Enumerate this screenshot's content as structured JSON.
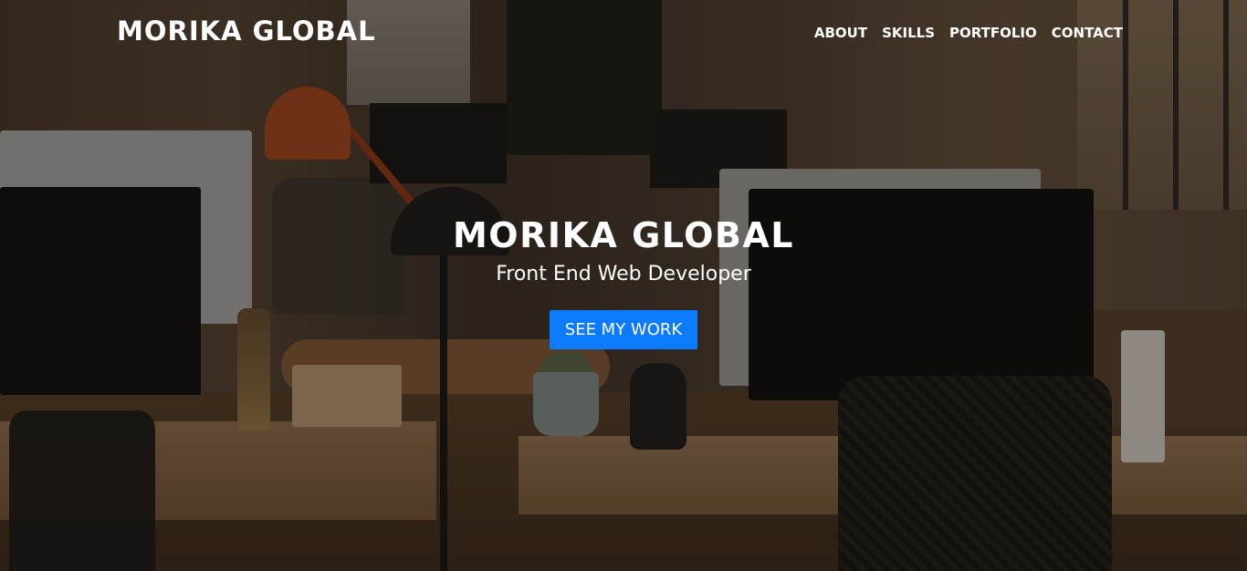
{
  "brand": {
    "name": "MORIKA GLOBAL"
  },
  "nav": {
    "items": [
      {
        "label": "ABOUT"
      },
      {
        "label": "SKILLS"
      },
      {
        "label": "PORTFOLIO"
      },
      {
        "label": "CONTACT"
      }
    ]
  },
  "hero": {
    "title": "MORIKA GLOBAL",
    "subtitle": "Front End Web Developer",
    "cta_label": "SEE MY WORK",
    "background": "office workspace photo with desks, computers and lamps",
    "accent_color": "#0d7bff"
  }
}
